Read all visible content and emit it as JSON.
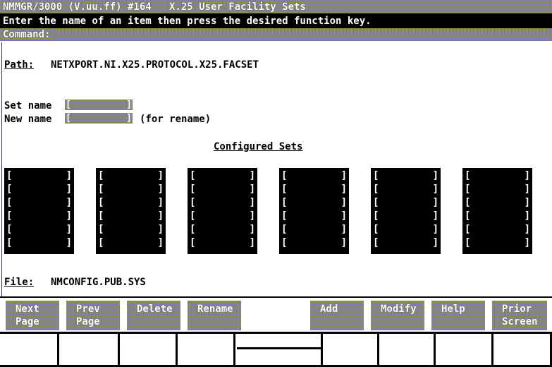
{
  "title_bar": {
    "text": "NMMGR/3000 (V.uu.ff) #164   X.25 User Facility Sets"
  },
  "message_line": {
    "text": "Enter the name of an item then press the desired function key."
  },
  "command_line": {
    "label": "Command:",
    "value": "",
    "placeholder": ""
  },
  "form": {
    "path_label": "Path:",
    "path_value": "NETXPORT.NI.X25.PROTOCOL.X25.FACSET",
    "set_name_label": "Set name",
    "set_name_value": "",
    "new_name_label": "New name",
    "new_name_value": "",
    "rename_hint": "(for rename)",
    "file_label": "File:",
    "file_value": "NMCONFIG.PUB.SYS",
    "bracket_open": "[",
    "bracket_close": "]"
  },
  "configured_sets": {
    "heading": "Configured Sets",
    "rows": 6,
    "columns": 6,
    "bracket_open": "[",
    "bracket_close": "]",
    "values": [
      [
        "",
        "",
        "",
        "",
        "",
        ""
      ],
      [
        "",
        "",
        "",
        "",
        "",
        ""
      ],
      [
        "",
        "",
        "",
        "",
        "",
        ""
      ],
      [
        "",
        "",
        "",
        "",
        "",
        ""
      ],
      [
        "",
        "",
        "",
        "",
        "",
        ""
      ],
      [
        "",
        "",
        "",
        "",
        "",
        ""
      ]
    ]
  },
  "function_keys": [
    {
      "line1": "Next",
      "line2": "Page"
    },
    {
      "line1": "Prev",
      "line2": "Page"
    },
    {
      "line1": "Delete",
      "line2": ""
    },
    {
      "line1": "Rename",
      "line2": ""
    },
    {
      "line1": "Add",
      "line2": ""
    },
    {
      "line1": "Modify",
      "line2": ""
    },
    {
      "line1": "Help",
      "line2": ""
    },
    {
      "line1": "Prior",
      "line2": "Screen"
    }
  ],
  "colors": {
    "background": "#ffffff",
    "foreground": "#000000",
    "inverse_text": "#ffffff",
    "message_bar": "#000000",
    "grid_fill": "#000000",
    "dither_blue": "#787cbe",
    "dither_olive": "#8c883c"
  }
}
